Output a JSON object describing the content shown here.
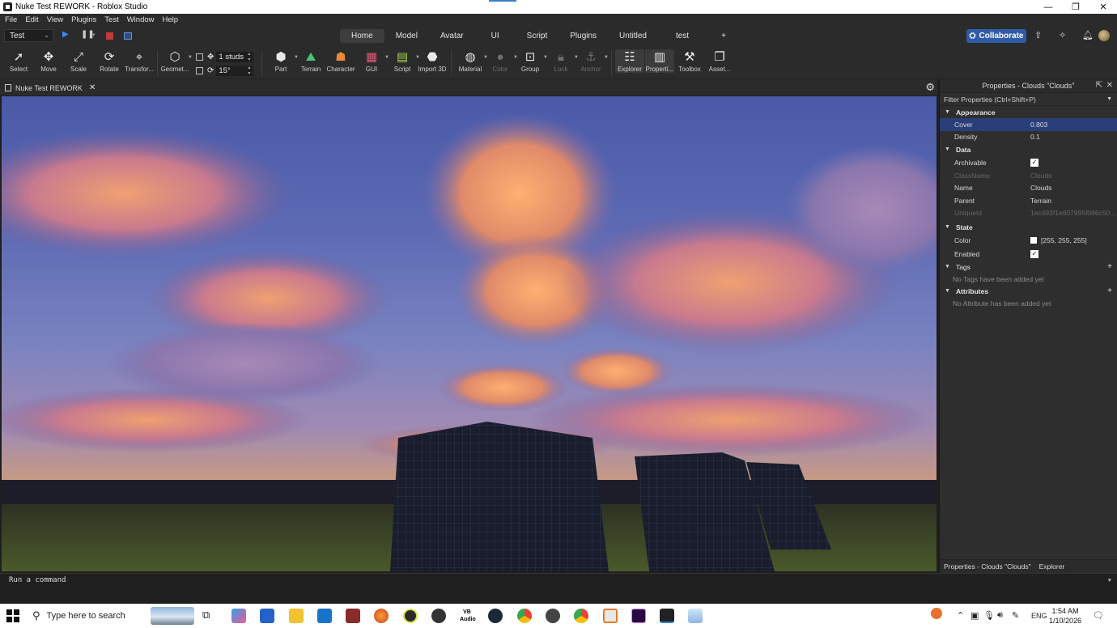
{
  "window": {
    "title": "Nuke Test REWORK - Roblox Studio",
    "controls": {
      "minimize": "—",
      "maximize": "❐",
      "close": "✕"
    }
  },
  "menu": [
    "File",
    "Edit",
    "View",
    "Plugins",
    "Test",
    "Window",
    "Help"
  ],
  "ribbon": {
    "mode": "Test",
    "tabs": [
      "Home",
      "Model",
      "Avatar",
      "UI",
      "Script",
      "Plugins",
      "Untitled",
      "test",
      "+"
    ],
    "active_tab": "Home",
    "collaborate": "Collaborate"
  },
  "toolbar": {
    "select": "Select",
    "move": "Move",
    "scale": "Scale",
    "rotate": "Rotate",
    "transform": "Transfor...",
    "geometry": "Geomet...",
    "snap_move": "1 studs",
    "snap_rotate": "15°",
    "part": "Part",
    "terrain": "Terrain",
    "character": "Character",
    "gui": "GUI",
    "script": "Script",
    "import3d": "Import 3D",
    "material": "Material",
    "color": "Color",
    "group": "Group",
    "lock": "Lock",
    "anchor": "Anchor",
    "explorer": "Explorer",
    "properties": "Properti...",
    "toolbox": "Toolbox",
    "assets": "Asset..."
  },
  "document": {
    "tab": "Nuke Test REWORK",
    "close": "✕"
  },
  "properties": {
    "header": "Properties - Clouds \"Clouds\"",
    "filter": "Filter Properties (Ctrl+Shift+P)",
    "appearance": {
      "title": "Appearance",
      "cover_label": "Cover",
      "cover_value": "0.803",
      "density_label": "Density",
      "density_value": "0.1"
    },
    "data": {
      "title": "Data",
      "archivable_label": "Archivable",
      "classname_label": "ClassName",
      "classname_value": "Clouds",
      "name_label": "Name",
      "name_value": "Clouds",
      "parent_label": "Parent",
      "parent_value": "Terrain",
      "uniqueid_label": "UniqueId",
      "uniqueid_value": "1ec493f1e607995f086c50..."
    },
    "state": {
      "title": "State",
      "color_label": "Color",
      "color_value": "[255, 255, 255]",
      "enabled_label": "Enabled"
    },
    "tags": {
      "title": "Tags",
      "empty": "No Tags have been added yet"
    },
    "attributes": {
      "title": "Attributes",
      "empty": "No Attribute has been added yet"
    },
    "footer_tabs": [
      "Properties - Clouds \"Clouds\"",
      "Explorer"
    ]
  },
  "command_bar": {
    "placeholder": "Run a command"
  },
  "taskbar": {
    "search_placeholder": "Type here to search",
    "language": "ENG",
    "time": "1:54 AM",
    "date": "1/10/2026"
  },
  "colors": {
    "accent": "#2f5ba8",
    "selection": "#2a3f7a",
    "sunset_orange": "#efb25a"
  }
}
